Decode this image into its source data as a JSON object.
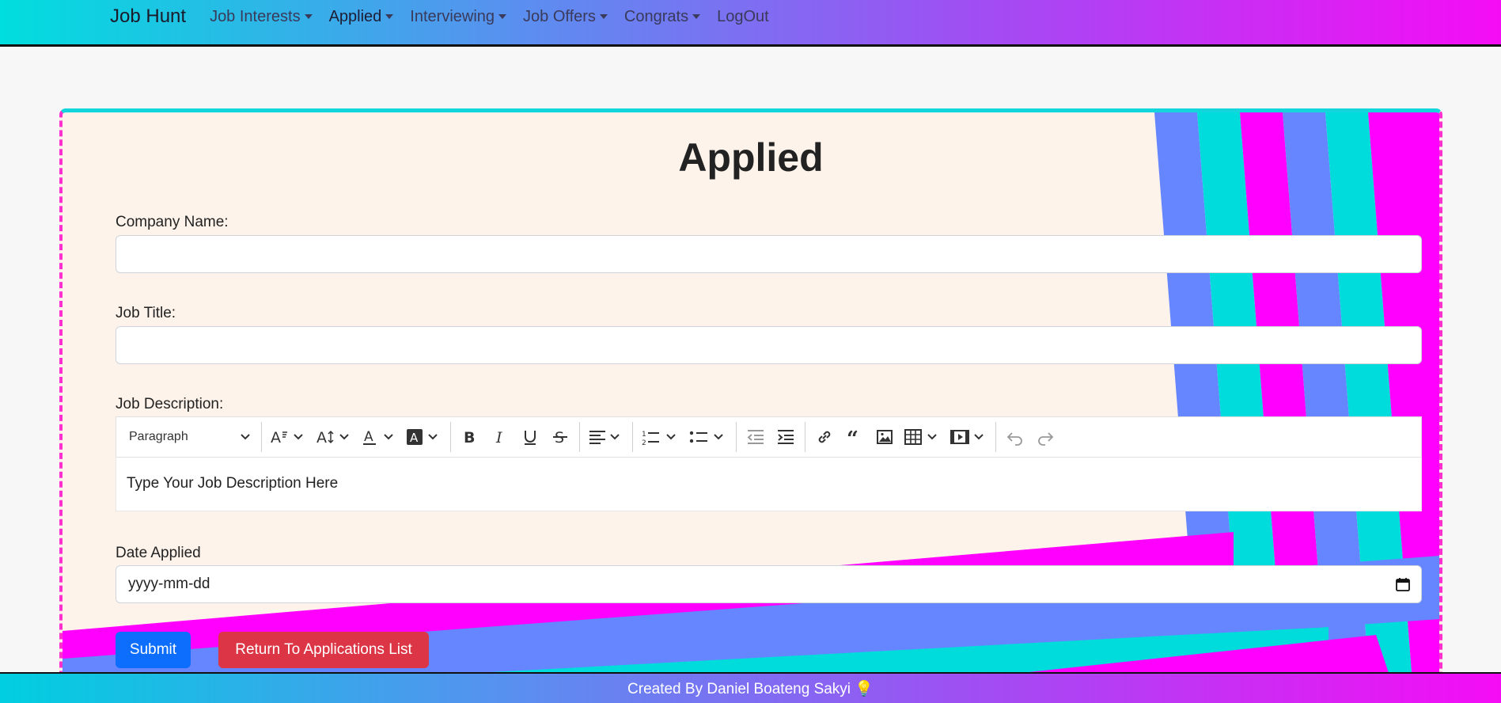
{
  "navbar": {
    "brand": "Job Hunt",
    "items": [
      {
        "label": "Job Interests",
        "dropdown": true
      },
      {
        "label": "Applied",
        "dropdown": true
      },
      {
        "label": "Interviewing",
        "dropdown": true
      },
      {
        "label": "Job Offers",
        "dropdown": true
      },
      {
        "label": "Congrats",
        "dropdown": true
      },
      {
        "label": "LogOut",
        "dropdown": false
      }
    ]
  },
  "form": {
    "title": "Applied",
    "company_label": "Company Name:",
    "company_value": "",
    "job_title_label": "Job Title:",
    "job_title_value": "",
    "description_label": "Job Description:",
    "description_placeholder": "Type Your Job Description Here",
    "date_label": "Date Applied",
    "date_placeholder": "yyyy-mm-dd",
    "submit_label": "Submit",
    "return_label": "Return To Applications List"
  },
  "editor_toolbar": {
    "heading_value": "Paragraph",
    "tools": [
      "font-size-icon",
      "font-family-icon",
      "font-color-icon",
      "font-background-icon",
      "bold-icon",
      "italic-icon",
      "underline-icon",
      "strikethrough-icon",
      "align-icon",
      "numbered-list-icon",
      "bulleted-list-icon",
      "outdent-icon",
      "indent-icon",
      "link-icon",
      "blockquote-icon",
      "image-icon",
      "table-icon",
      "media-icon",
      "undo-icon",
      "redo-icon"
    ]
  },
  "footer": {
    "text": "Created By Daniel Boateng Sakyi 💡"
  },
  "colors": {
    "cyan": "#00dcdc",
    "blue": "#6686ff",
    "magenta": "#ff00ff",
    "primary": "#0d6efd",
    "danger": "#dc3545"
  }
}
